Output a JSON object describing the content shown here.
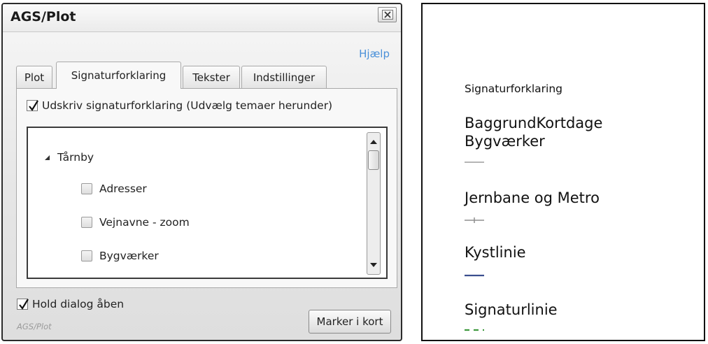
{
  "dialog": {
    "title": "AGS/Plot",
    "help_link": "Hjælp",
    "tabs": [
      {
        "label": "Plot"
      },
      {
        "label": "Signaturforklaring"
      },
      {
        "label": "Tekster"
      },
      {
        "label": "Indstillinger"
      }
    ],
    "active_tab": "Signaturforklaring",
    "print_legend": {
      "label": "Udskriv signaturforklaring (Udvælg temaer herunder)",
      "checked": true
    },
    "tree": {
      "group": "Tårnby",
      "items": [
        {
          "label": "Adresser",
          "checked": false
        },
        {
          "label": "Vejnavne - zoom",
          "checked": false
        },
        {
          "label": "Bygværker",
          "checked": false
        }
      ]
    },
    "hold_dialog": {
      "label": "Hold dialog åben",
      "checked": true
    },
    "footer_label": "AGS/Plot",
    "marker_button": "Marker i kort"
  },
  "legend": {
    "heading": "Signaturforklaring",
    "items": [
      {
        "label": "BaggrundKortdage\nBygværker",
        "symbol": "gray-line",
        "color": "#b5b5b5"
      },
      {
        "label": "Jernbane og Metro",
        "symbol": "rail-line",
        "color": "#8f8f8f"
      },
      {
        "label": "Kystlinie",
        "symbol": "solid-line",
        "color": "#3b4f8f"
      },
      {
        "label": "Signaturlinie",
        "symbol": "dashed-line",
        "color": "#3f9a3f"
      }
    ]
  }
}
